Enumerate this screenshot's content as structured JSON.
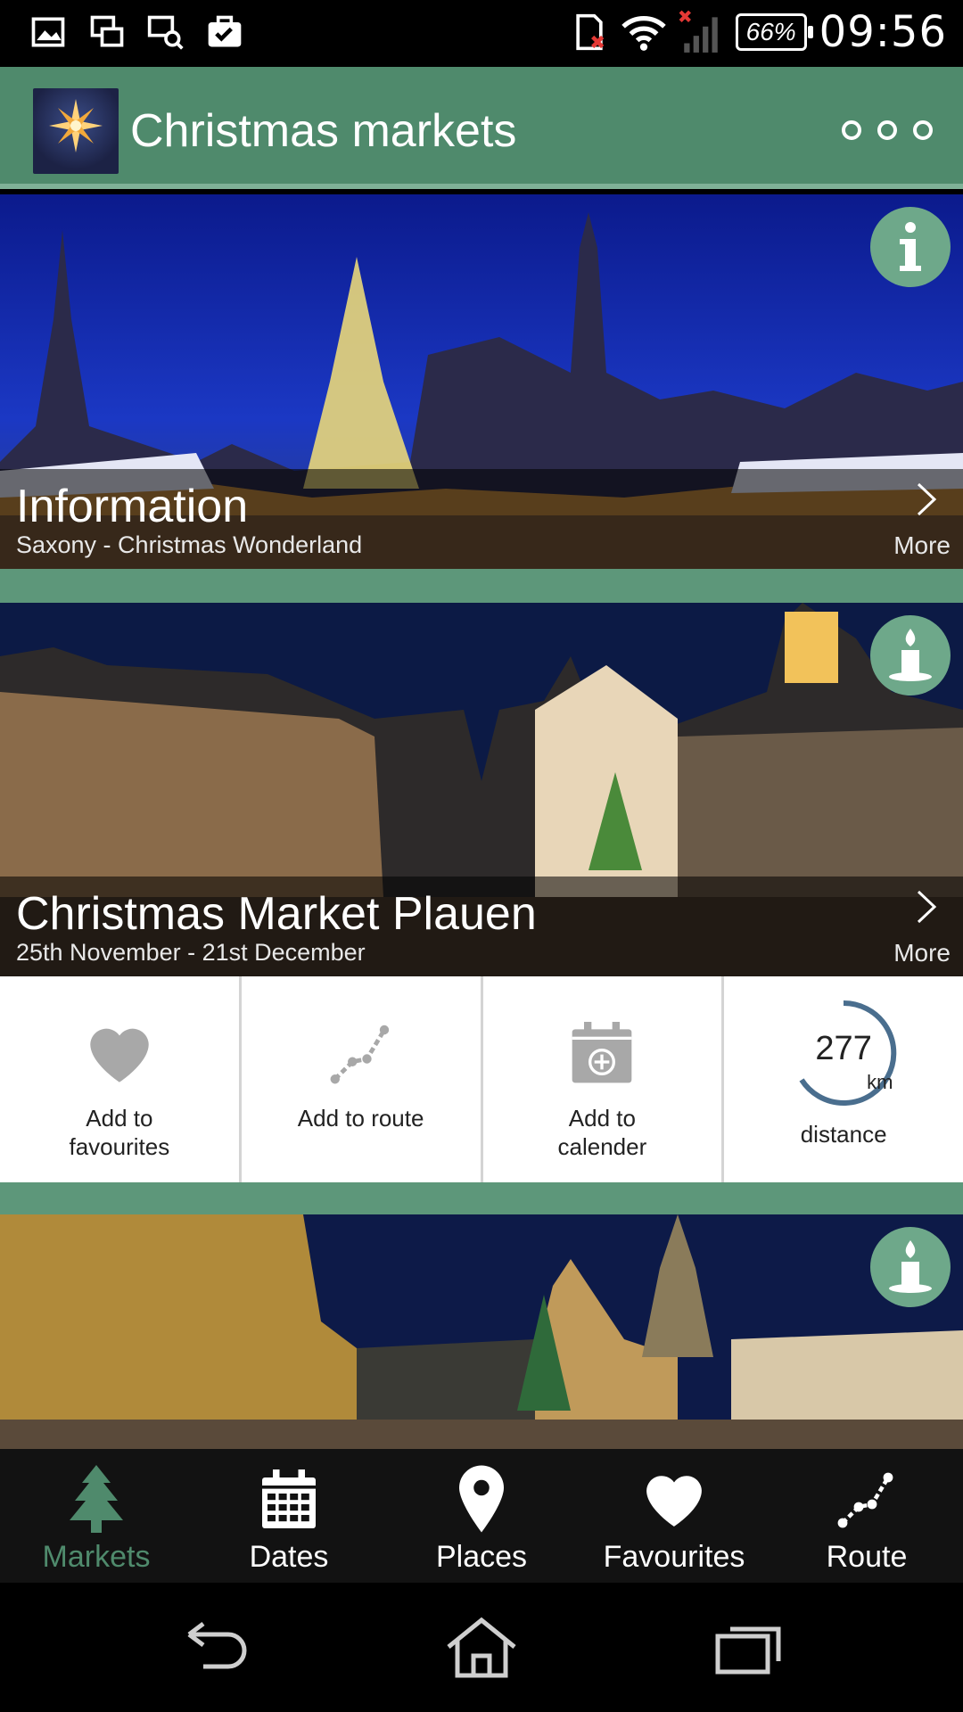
{
  "status_bar": {
    "battery": "66%",
    "time": "09:56"
  },
  "app_bar": {
    "title": "Christmas markets"
  },
  "cards": [
    {
      "title": "Information",
      "subtitle": "Saxony - Christmas Wonderland",
      "more": "More",
      "badge_icon": "info-icon"
    },
    {
      "title": "Christmas Market Plauen",
      "subtitle": "25th November - 21st December",
      "more": "More",
      "badge_icon": "candle-icon"
    },
    {
      "badge_icon": "candle-icon"
    }
  ],
  "actions": {
    "favourites": "Add to\nfavourites",
    "route": "Add to route",
    "calendar": "Add to\ncalender",
    "distance_value": "277",
    "distance_unit": "km",
    "distance_label": "distance"
  },
  "bottom_nav": {
    "items": [
      {
        "label": "Markets",
        "icon": "tree-icon",
        "active": true
      },
      {
        "label": "Dates",
        "icon": "calendar-icon"
      },
      {
        "label": "Places",
        "icon": "map-pin-icon"
      },
      {
        "label": "Favourites",
        "icon": "heart-icon"
      },
      {
        "label": "Route",
        "icon": "route-icon"
      }
    ]
  },
  "colors": {
    "accent": "#4f8a6c",
    "accent_light": "#6ea88a",
    "gauge_ring": "#4a6e8e"
  }
}
